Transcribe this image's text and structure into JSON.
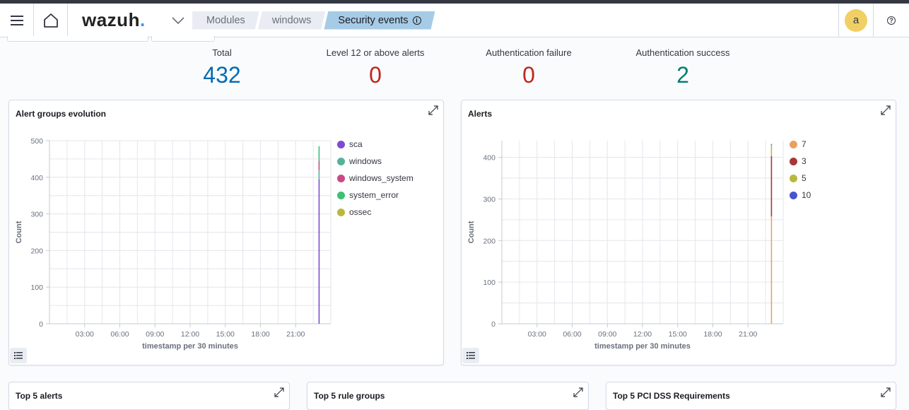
{
  "header": {
    "logo_text": "wazuh",
    "logo_dot": ".",
    "breadcrumbs": [
      "Modules",
      "windows",
      "Security events"
    ],
    "avatar_initial": "a",
    "help_symbol": "?",
    "info_symbol": "i"
  },
  "stats": [
    {
      "label": "Total",
      "value": "432",
      "color": "#006bb4"
    },
    {
      "label": "Level 12 or above alerts",
      "value": "0",
      "color": "#bd271e"
    },
    {
      "label": "Authentication failure",
      "value": "0",
      "color": "#bd271e"
    },
    {
      "label": "Authentication success",
      "value": "2",
      "color": "#017d73"
    }
  ],
  "panels": {
    "alert_groups": {
      "title": "Alert groups evolution"
    },
    "alerts": {
      "title": "Alerts"
    },
    "top5_alerts": {
      "title": "Top 5 alerts"
    },
    "top5_rule_groups": {
      "title": "Top 5 rule groups"
    },
    "top5_pci": {
      "title": "Top 5 PCI DSS Requirements"
    }
  },
  "chart_data": [
    {
      "type": "bar",
      "title": "Alert groups evolution",
      "xlabel": "timestamp per 30 minutes",
      "ylabel": "Count",
      "x_ticks": [
        "03:00",
        "06:00",
        "09:00",
        "12:00",
        "15:00",
        "18:00",
        "21:00"
      ],
      "y_ticks": [
        0,
        100,
        200,
        300,
        400,
        500
      ],
      "ylim": [
        0,
        500
      ],
      "legend_position": "right",
      "grid": true,
      "stacked": true,
      "x_bucket": "23:00",
      "series": [
        {
          "name": "sca",
          "color": "#7e4bd1",
          "values": [
            395
          ]
        },
        {
          "name": "windows",
          "color": "#54b399",
          "values": [
            25
          ]
        },
        {
          "name": "windows_system",
          "color": "#ca4987",
          "values": [
            25
          ]
        },
        {
          "name": "system_error",
          "color": "#3bc077",
          "values": [
            40
          ]
        },
        {
          "name": "ossec",
          "color": "#b9b83e",
          "values": [
            0
          ]
        }
      ]
    },
    {
      "type": "bar",
      "title": "Alerts",
      "xlabel": "timestamp per 30 minutes",
      "ylabel": "Count",
      "x_ticks": [
        "03:00",
        "06:00",
        "09:00",
        "12:00",
        "15:00",
        "18:00",
        "21:00"
      ],
      "y_ticks": [
        0,
        100,
        200,
        300,
        400
      ],
      "ylim": [
        0,
        440
      ],
      "legend_position": "right",
      "grid": true,
      "stacked": true,
      "x_bucket": "23:00",
      "series": [
        {
          "name": "7",
          "color": "#e7a25e",
          "values": [
            258
          ]
        },
        {
          "name": "3",
          "color": "#a93538",
          "values": [
            145
          ]
        },
        {
          "name": "5",
          "color": "#b9b83e",
          "values": [
            27
          ]
        },
        {
          "name": "10",
          "color": "#4753d0",
          "values": [
            2
          ]
        }
      ]
    }
  ]
}
